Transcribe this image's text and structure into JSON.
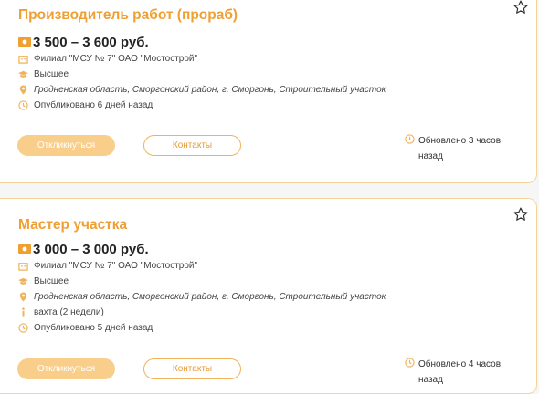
{
  "colors": {
    "accent": "#f0a033",
    "icon": "#f0b35c",
    "apply_bg": "#f9cd8a",
    "border": "#f2d49a"
  },
  "cards": [
    {
      "title": "Производитель работ (прораб)",
      "salary": "3 500 – 3 600 руб.",
      "company": "Филиал \"МСУ № 7\" ОАО \"Мостострой\"",
      "education": "Высшее",
      "location": "Гродненская область, Сморгонский район, г. Сморгонь, Строительный участок",
      "published": "Опубликовано 6 дней назад",
      "apply_label": "Откликнуться",
      "contacts_label": "Контакты",
      "updated": "Обновлено 3 часов назад"
    },
    {
      "title": "Мастер участка",
      "salary": "3 000 – 3 000 руб.",
      "company": "Филиал \"МСУ № 7\" ОАО \"Мостострой\"",
      "education": "Высшее",
      "location": "Гродненская область, Сморгонский район, г. Сморгонь, Строительный участок",
      "schedule": "вахта (2 недели)",
      "published": "Опубликовано 5 дней назад",
      "apply_label": "Откликнуться",
      "contacts_label": "Контакты",
      "updated": "Обновлено 4 часов назад"
    }
  ]
}
